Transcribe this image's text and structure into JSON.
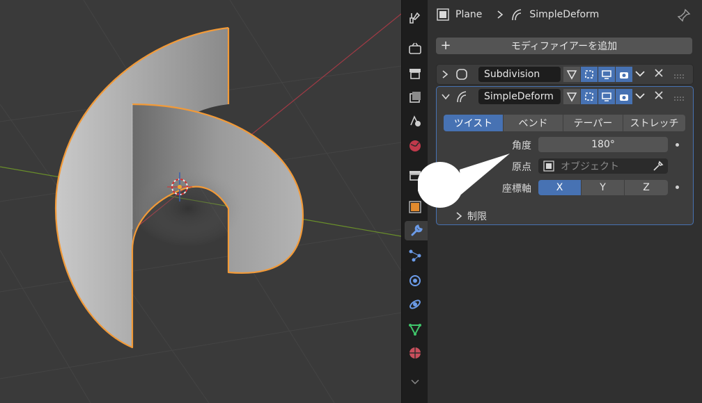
{
  "breadcrumb": {
    "object": "Plane",
    "modifier": "SimpleDeform"
  },
  "add_modifier_label": "モディファイアーを追加",
  "modifiers": [
    {
      "name": "Subdivision",
      "expanded": false
    },
    {
      "name": "SimpleDeform",
      "expanded": true
    }
  ],
  "simple_deform": {
    "modes": [
      "ツイスト",
      "ベンド",
      "テーパー",
      "ストレッチ"
    ],
    "active_mode": "ツイスト",
    "angle_label": "角度",
    "angle_value": "180°",
    "origin_label": "原点",
    "origin_placeholder": "オブジェクト",
    "axis_label": "座標軸",
    "axes": [
      "X",
      "Y",
      "Z"
    ],
    "active_axis": "X",
    "restrictions_label": "制限"
  },
  "tabs": [
    "tool-icon",
    "render-icon",
    "output-icon",
    "view-layer-icon",
    "scene-icon",
    "world-icon",
    "collection-icon",
    "object-icon",
    "modifier-icon",
    "particles-icon",
    "physics-icon",
    "constraints-icon",
    "data-icon",
    "material-icon"
  ],
  "colors": {
    "accent": "#4772b3",
    "selection": "#f29a38",
    "panel": "#303030",
    "viewport": "#3a3a3a"
  }
}
